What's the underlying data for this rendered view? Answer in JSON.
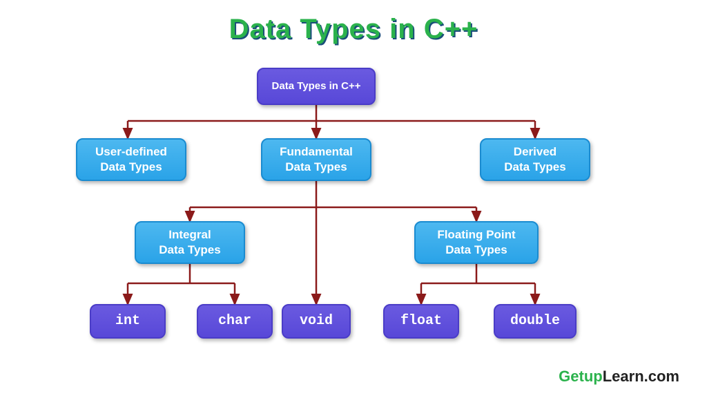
{
  "title": "Data Types in C++",
  "root": {
    "label": "Data Types in C++"
  },
  "level1": {
    "userDefined": {
      "line1": "User-defined",
      "line2": "Data Types"
    },
    "fundamental": {
      "line1": "Fundamental",
      "line2": "Data  Types"
    },
    "derived": {
      "line1": "Derived",
      "line2": "Data Types"
    }
  },
  "level2": {
    "integral": {
      "line1": "Integral",
      "line2": "Data Types"
    },
    "floating": {
      "line1": "Floating  Point",
      "line2": "Data Types"
    }
  },
  "leaves": {
    "int": "int",
    "char": "char",
    "void": "void",
    "float": "float",
    "double": "double"
  },
  "watermark": {
    "part1": "Getup",
    "part2": "Learn",
    "part3": ".com"
  }
}
